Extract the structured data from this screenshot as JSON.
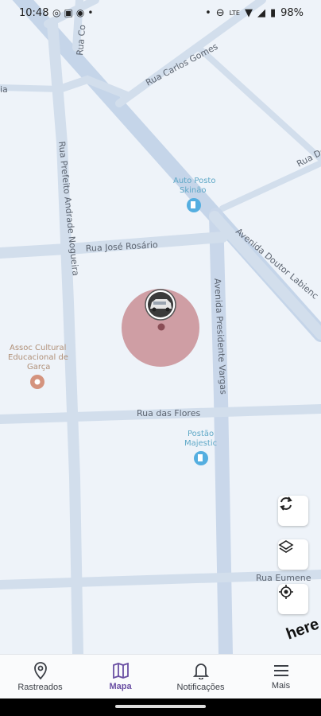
{
  "status_bar": {
    "time": "10:48",
    "battery": "98%",
    "network": "LTE"
  },
  "map": {
    "streets": {
      "ruaCo": "Rua Co",
      "carlos_gomes": "Rua Carlos Gomes",
      "rua_do": "Rua Do",
      "prefeito": "Rua Prefeito Andrade Nogueira",
      "jose_rosario": "Rua José Rosário",
      "doutor_labienc": "Avenida Doutor Labienc",
      "presidente_vargas": "Avenida Presidente Vargas",
      "flores": "Rua das Flores",
      "eumene": "Rua Eumene",
      "edge_ia": "ia"
    },
    "pois": {
      "auto_posto_line1": "Auto Posto",
      "auto_posto_line2": "Skinão",
      "assoc_line1": "Assoc Cultural",
      "assoc_line2": "Educacional de",
      "assoc_line3": "Garça",
      "postao_line1": "Postão",
      "postao_line2": "Majestic"
    },
    "logo": "here",
    "geofence_color": "#c98e95"
  },
  "tabs": [
    {
      "label": "Rastreados",
      "icon": "location-pin-icon"
    },
    {
      "label": "Mapa",
      "icon": "map-icon"
    },
    {
      "label": "Notificações",
      "icon": "bell-icon"
    },
    {
      "label": "Mais",
      "icon": "menu-icon"
    }
  ],
  "active_tab": "Mapa",
  "colors": {
    "accent": "#6a4fa3",
    "road": "#c7d6ea",
    "map_bg": "#eef3f9"
  }
}
